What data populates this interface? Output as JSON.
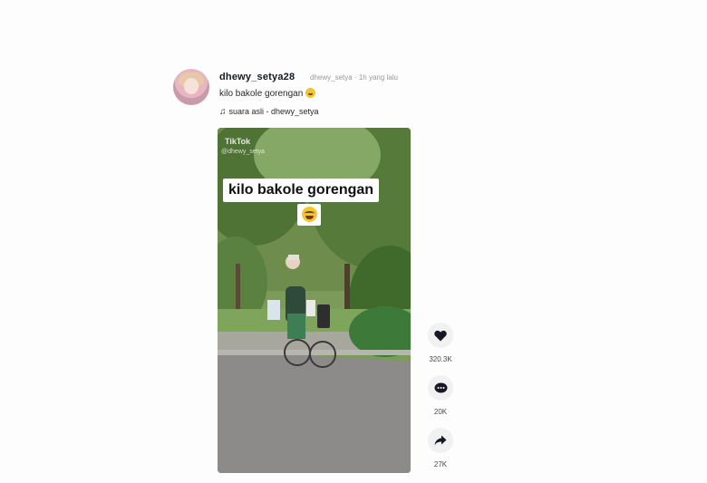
{
  "post": {
    "username": "dhewy_setya28",
    "handle": "dhewy_setya",
    "time": "1h yang lalu",
    "caption": "kilo bakole gorengan",
    "sound": "suara asli - dhewy_setya"
  },
  "video": {
    "watermark": "TikTok",
    "watermark_handle": "@dhewy_setya",
    "overlay_text": "kilo bakole gorengan"
  },
  "actions": {
    "likes": "320.3K",
    "comments": "20K",
    "shares": "27K"
  },
  "icons": {
    "like": "heart-icon",
    "comment": "comment-icon",
    "share": "share-icon",
    "sound": "music-note-icon"
  }
}
